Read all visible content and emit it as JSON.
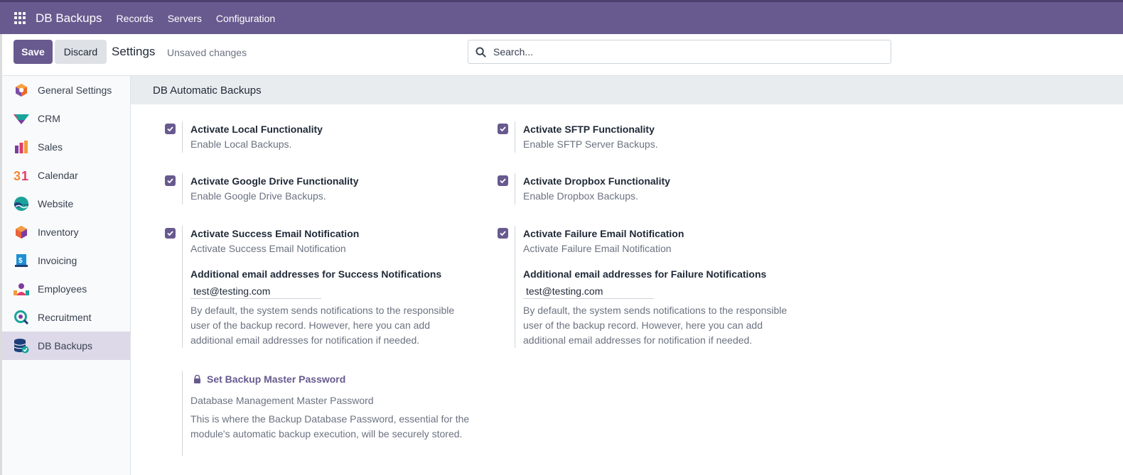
{
  "navbar": {
    "brand": "DB Backups",
    "menu": [
      "Records",
      "Servers",
      "Configuration"
    ]
  },
  "control_panel": {
    "save_label": "Save",
    "discard_label": "Discard",
    "title": "Settings",
    "status": "Unsaved changes",
    "search_placeholder": "Search..."
  },
  "sidebar": {
    "items": [
      {
        "label": "General Settings",
        "icon": "general-settings-icon"
      },
      {
        "label": "CRM",
        "icon": "crm-icon"
      },
      {
        "label": "Sales",
        "icon": "sales-icon"
      },
      {
        "label": "Calendar",
        "icon": "calendar-icon"
      },
      {
        "label": "Website",
        "icon": "website-icon"
      },
      {
        "label": "Inventory",
        "icon": "inventory-icon"
      },
      {
        "label": "Invoicing",
        "icon": "invoicing-icon"
      },
      {
        "label": "Employees",
        "icon": "employees-icon"
      },
      {
        "label": "Recruitment",
        "icon": "recruitment-icon"
      },
      {
        "label": "DB Backups",
        "icon": "db-backups-icon",
        "active": true
      }
    ]
  },
  "section": {
    "title": "DB Automatic Backups",
    "settings": {
      "local": {
        "title": "Activate Local Functionality",
        "desc": "Enable Local Backups.",
        "checked": true
      },
      "sftp": {
        "title": "Activate SFTP Functionality",
        "desc": "Enable SFTP Server Backups.",
        "checked": true
      },
      "gdrive": {
        "title": "Activate Google Drive Functionality",
        "desc": "Enable Google Drive Backups.",
        "checked": true
      },
      "dropbox": {
        "title": "Activate Dropbox Functionality",
        "desc": "Enable Dropbox Backups.",
        "checked": true
      },
      "success": {
        "title": "Activate Success Email Notification",
        "desc": "Activate Success Email Notification",
        "checked": true,
        "email_label": "Additional email addresses for Success Notifications",
        "email_value": "test@testing.com",
        "help": "By default, the system sends notifications to the responsible user of the backup record. However, here you can add additional email addresses for notification if needed."
      },
      "failure": {
        "title": "Activate Failure Email Notification",
        "desc": "Activate Failure Email Notification",
        "checked": true,
        "email_label": "Additional email addresses for Failure Notifications",
        "email_value": "test@testing.com",
        "help": "By default, the system sends notifications to the responsible user of the backup record. However, here you can add additional email addresses for notification if needed."
      },
      "password": {
        "link": "Set Backup Master Password",
        "desc": "Database Management Master Password",
        "help": "This is where the Backup Database Password, essential for the module's automatic backup execution, will be securely stored."
      }
    }
  },
  "colors": {
    "brand": "#685a8f",
    "navbar_border": "#4b3f6b",
    "section_bg": "#e9ecef",
    "active_side": "#ddd9e8"
  }
}
